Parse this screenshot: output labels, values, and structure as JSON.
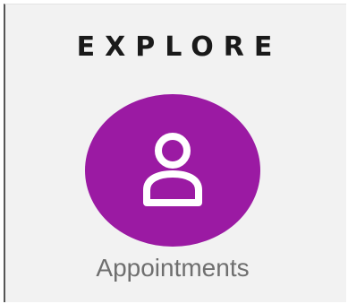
{
  "header": {
    "title": "EXPLORE"
  },
  "tiles": [
    {
      "label": "Appointments",
      "icon": "user-icon",
      "color": "#9b1aa3"
    }
  ]
}
